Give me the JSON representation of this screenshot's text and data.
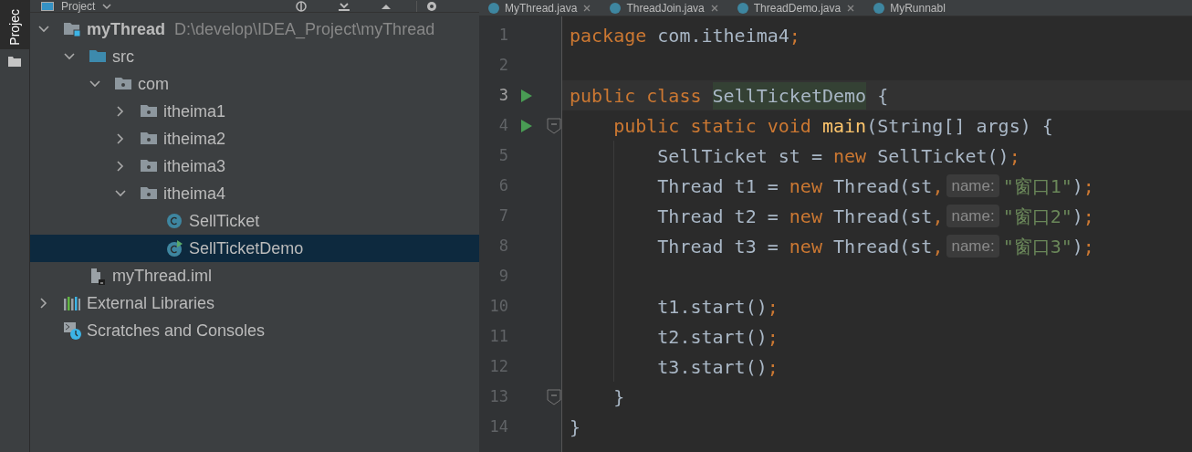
{
  "tool_strip": {
    "tab": "Projec",
    "selected": true
  },
  "project_panel": {
    "title": "Project",
    "tree": [
      {
        "kind": "module",
        "label": "myThread",
        "path": "D:\\develop\\IDEA_Project\\myThread",
        "expanded": true,
        "selected": false,
        "children": [
          {
            "kind": "source",
            "label": "src",
            "expanded": true,
            "selected": false,
            "children": [
              {
                "kind": "package",
                "label": "com",
                "expanded": true,
                "selected": false,
                "children": [
                  {
                    "kind": "package",
                    "label": "itheima1",
                    "expanded": false,
                    "selected": false
                  },
                  {
                    "kind": "package",
                    "label": "itheima2",
                    "expanded": false,
                    "selected": false
                  },
                  {
                    "kind": "package",
                    "label": "itheima3",
                    "expanded": false,
                    "selected": false
                  },
                  {
                    "kind": "package",
                    "label": "itheima4",
                    "expanded": true,
                    "selected": false,
                    "children": [
                      {
                        "kind": "class",
                        "label": "SellTicket",
                        "selected": false
                      },
                      {
                        "kind": "runnable-class",
                        "label": "SellTicketDemo",
                        "selected": true
                      }
                    ]
                  }
                ]
              }
            ]
          },
          {
            "kind": "iml",
            "label": "myThread.iml",
            "selected": false
          }
        ]
      },
      {
        "kind": "libraries",
        "label": "External Libraries",
        "expanded": false,
        "selected": false
      },
      {
        "kind": "scratches",
        "label": "Scratches and Consoles",
        "selected": false
      }
    ]
  },
  "editor": {
    "tabs": [
      {
        "label": "MyThread.java",
        "closable": true
      },
      {
        "label": "ThreadJoin.java",
        "closable": true
      },
      {
        "label": "ThreadDemo.java",
        "closable": true
      },
      {
        "label": "MyRunnabl",
        "closable": false
      }
    ],
    "lines": [
      {
        "number": "1",
        "current": false,
        "run": false,
        "fold": false,
        "indent_guide": false,
        "tokens": [
          {
            "kind": "keyword",
            "text": "package "
          },
          {
            "kind": "plain",
            "text": "com.itheima4"
          },
          {
            "kind": "keyword",
            "text": ";"
          }
        ]
      },
      {
        "number": "2",
        "current": false,
        "run": false,
        "fold": false,
        "indent_guide": false
      },
      {
        "number": "3",
        "current": true,
        "run": true,
        "fold": false,
        "indent_guide": false,
        "tokens": [
          {
            "kind": "keyword",
            "text": "public class "
          },
          {
            "kind": "declaration",
            "text": "SellTicketDemo"
          },
          {
            "kind": "plain",
            "text": " {"
          }
        ]
      },
      {
        "number": "4",
        "current": false,
        "run": true,
        "fold": true,
        "indent_guide": false,
        "tokens": [
          {
            "kind": "keyword",
            "text": "    public static void "
          },
          {
            "kind": "method",
            "text": "main"
          },
          {
            "kind": "plain",
            "text": "(String[] args) {"
          }
        ]
      },
      {
        "number": "5",
        "current": false,
        "run": false,
        "fold": false,
        "indent_guide": true,
        "tokens": [
          {
            "kind": "plain",
            "text": "        SellTicket st = "
          },
          {
            "kind": "keyword",
            "text": "new "
          },
          {
            "kind": "plain",
            "text": "SellTicket()"
          },
          {
            "kind": "keyword",
            "text": ";"
          }
        ]
      },
      {
        "number": "6",
        "current": false,
        "run": false,
        "fold": false,
        "indent_guide": true,
        "tokens": [
          {
            "kind": "plain",
            "text": "        Thread t1 = "
          },
          {
            "kind": "keyword",
            "text": "new "
          },
          {
            "kind": "plain",
            "text": "Thread(st"
          },
          {
            "kind": "keyword",
            "text": ","
          },
          {
            "kind": "hint",
            "text": "name:"
          },
          {
            "kind": "string",
            "text": "\"窗口1\""
          },
          {
            "kind": "plain",
            "text": ")"
          },
          {
            "kind": "keyword",
            "text": ";"
          }
        ]
      },
      {
        "number": "7",
        "current": false,
        "run": false,
        "fold": false,
        "indent_guide": true,
        "tokens": [
          {
            "kind": "plain",
            "text": "        Thread t2 = "
          },
          {
            "kind": "keyword",
            "text": "new "
          },
          {
            "kind": "plain",
            "text": "Thread(st"
          },
          {
            "kind": "keyword",
            "text": ","
          },
          {
            "kind": "hint",
            "text": "name:"
          },
          {
            "kind": "string",
            "text": "\"窗口2\""
          },
          {
            "kind": "plain",
            "text": ")"
          },
          {
            "kind": "keyword",
            "text": ";"
          }
        ]
      },
      {
        "number": "8",
        "current": false,
        "run": false,
        "fold": false,
        "indent_guide": true,
        "tokens": [
          {
            "kind": "plain",
            "text": "        Thread t3 = "
          },
          {
            "kind": "keyword",
            "text": "new "
          },
          {
            "kind": "plain",
            "text": "Thread(st"
          },
          {
            "kind": "keyword",
            "text": ","
          },
          {
            "kind": "hint",
            "text": "name:"
          },
          {
            "kind": "string",
            "text": "\"窗口3\""
          },
          {
            "kind": "plain",
            "text": ")"
          },
          {
            "kind": "keyword",
            "text": ";"
          }
        ]
      },
      {
        "number": "9",
        "current": false,
        "run": false,
        "fold": false,
        "indent_guide": true
      },
      {
        "number": "10",
        "current": false,
        "run": false,
        "fold": false,
        "indent_guide": true,
        "tokens": [
          {
            "kind": "plain",
            "text": "        t1.start()"
          },
          {
            "kind": "keyword",
            "text": ";"
          }
        ]
      },
      {
        "number": "11",
        "current": false,
        "run": false,
        "fold": false,
        "indent_guide": true,
        "tokens": [
          {
            "kind": "plain",
            "text": "        t2.start()"
          },
          {
            "kind": "keyword",
            "text": ";"
          }
        ]
      },
      {
        "number": "12",
        "current": false,
        "run": false,
        "fold": false,
        "indent_guide": true,
        "tokens": [
          {
            "kind": "plain",
            "text": "        t3.start()"
          },
          {
            "kind": "keyword",
            "text": ";"
          }
        ]
      },
      {
        "number": "13",
        "current": false,
        "run": false,
        "fold": true,
        "indent_guide": false,
        "tokens": [
          {
            "kind": "plain",
            "text": "    }"
          }
        ]
      },
      {
        "number": "14",
        "current": false,
        "run": false,
        "fold": false,
        "indent_guide": false,
        "tokens": [
          {
            "kind": "plain",
            "text": "}"
          }
        ]
      }
    ]
  }
}
